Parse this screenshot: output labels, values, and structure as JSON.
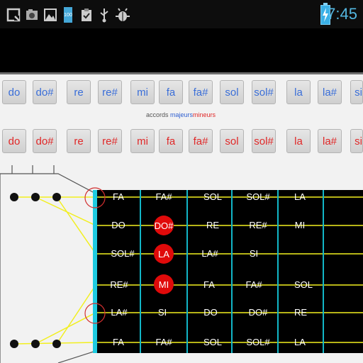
{
  "status": {
    "time": "7:45",
    "battery_level": "100",
    "icons": [
      "search-icon",
      "screenshot-icon",
      "picture-icon",
      "battery-100-icon",
      "clipboard-check-icon",
      "usb-icon",
      "debug-bug-icon"
    ]
  },
  "keys": [
    "do",
    "do#",
    "re",
    "re#",
    "mi",
    "fa",
    "fa#",
    "sol",
    "sol#",
    "la",
    "la#",
    "si"
  ],
  "legend": {
    "prefix": "accords",
    "major": "majeurs",
    "minor": "mineurs"
  },
  "fretboard": {
    "rows": [
      [
        "FA",
        "FA#",
        "SOL",
        "SOL#",
        "LA"
      ],
      [
        "DO",
        "DO#",
        "RE",
        "RE#",
        "MI"
      ],
      [
        "SOL#",
        "LA",
        "LA#",
        "SI",
        ""
      ],
      [
        "RE#",
        "MI",
        "FA",
        "FA#",
        "SOL"
      ],
      [
        "LA#",
        "SI",
        "DO",
        "DO#",
        "RE"
      ],
      [
        "FA",
        "FA#",
        "SOL",
        "SOL#",
        "LA"
      ]
    ],
    "highlighted": [
      {
        "row": 1,
        "col": 1,
        "label": "DO#"
      },
      {
        "row": 2,
        "col": 1,
        "label": "LA"
      },
      {
        "row": 3,
        "col": 1,
        "label": "MI"
      }
    ]
  },
  "colors": {
    "accent_blue": "#3a6ed8",
    "accent_red": "#e02828",
    "fret_cyan": "#12b6c7",
    "string_yellow": "#f2ef1f"
  }
}
